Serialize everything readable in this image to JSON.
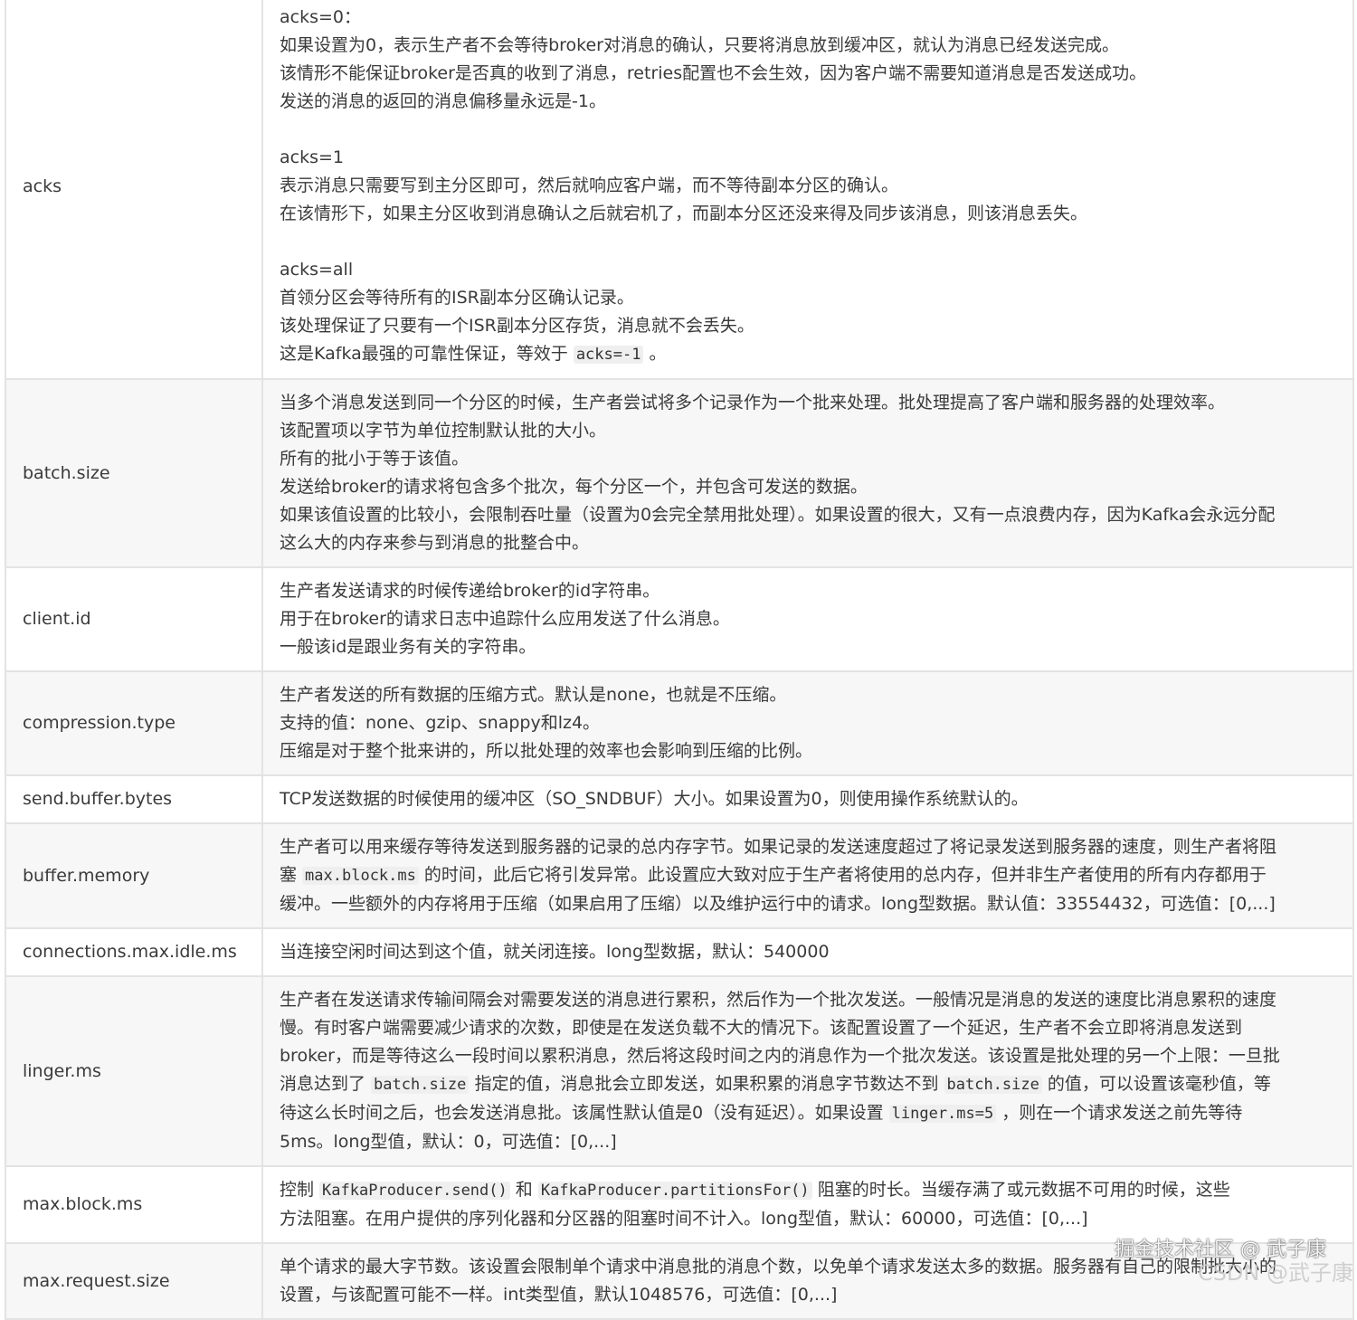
{
  "rows": [
    {
      "key": "acks",
      "lines": [
        "acks=0：",
        "如果设置为0，表示生产者不会等待broker对消息的确认，只要将消息放到缓冲区，就认为消息已经发送完成。",
        "该情形不能保证broker是否真的收到了消息，retries配置也不会生效，因为客户端不需要知道消息是否发送成功。",
        "发送的消息的返回的消息偏移量永远是-1。",
        "",
        "acks=1",
        "表示消息只需要写到主分区即可，然后就响应客户端，而不等待副本分区的确认。",
        "在该情形下，如果主分区收到消息确认之后就宕机了，而副本分区还没来得及同步该消息，则该消息丢失。",
        "",
        "acks=all",
        "首领分区会等待所有的ISR副本分区确认记录。",
        "该处理保证了只要有一个ISR副本分区存货，消息就不会丢失。",
        "这是Kafka最强的可靠性保证，等效于 `acks=-1` 。"
      ]
    },
    {
      "key": "batch.size",
      "lines": [
        "当多个消息发送到同一个分区的时候，生产者尝试将多个记录作为一个批来处理。批处理提高了客户端和服务器的处理效率。",
        "该配置项以字节为单位控制默认批的大小。",
        "所有的批小于等于该值。",
        "发送给broker的请求将包含多个批次，每个分区一个，并包含可发送的数据。",
        "如果该值设置的比较小，会限制吞吐量（设置为0会完全禁用批处理）。如果设置的很大，又有一点浪费内存，因为Kafka会永远分配",
        "这么大的内存来参与到消息的批整合中。"
      ]
    },
    {
      "key": "client.id",
      "lines": [
        "生产者发送请求的时候传递给broker的id字符串。",
        "用于在broker的请求日志中追踪什么应用发送了什么消息。",
        "一般该id是跟业务有关的字符串。"
      ]
    },
    {
      "key": "compression.type",
      "lines": [
        "生产者发送的所有数据的压缩方式。默认是none，也就是不压缩。",
        "支持的值：none、gzip、snappy和lz4。",
        "压缩是对于整个批来讲的，所以批处理的效率也会影响到压缩的比例。"
      ]
    },
    {
      "key": "send.buffer.bytes",
      "lines": [
        "TCP发送数据的时候使用的缓冲区（SO_SNDBUF）大小。如果设置为0，则使用操作系统默认的。"
      ]
    },
    {
      "key": "buffer.memory",
      "lines": [
        "生产者可以用来缓存等待发送到服务器的记录的总内存字节。如果记录的发送速度超过了将记录发送到服务器的速度，则生产者将阻",
        "塞 `max.block.ms` 的时间，此后它将引发异常。此设置应大致对应于生产者将使用的总内存，但并非生产者使用的所有内存都用于",
        "缓冲。一些额外的内存将用于压缩（如果启用了压缩）以及维护运行中的请求。long型数据。默认值：33554432，可选值：[0,...]"
      ]
    },
    {
      "key": "connections.max.idle.ms",
      "lines": [
        "当连接空闲时间达到这个值，就关闭连接。long型数据，默认：540000"
      ]
    },
    {
      "key": "linger.ms",
      "lines": [
        "生产者在发送请求传输间隔会对需要发送的消息进行累积，然后作为一个批次发送。一般情况是消息的发送的速度比消息累积的速度",
        "慢。有时客户端需要减少请求的次数，即使是在发送负载不大的情况下。该配置设置了一个延迟，生产者不会立即将消息发送到",
        "broker，而是等待这么一段时间以累积消息，然后将这段时间之内的消息作为一个批次发送。该设置是批处理的另一个上限：一旦批",
        "消息达到了 `batch.size` 指定的值，消息批会立即发送，如果积累的消息字节数达不到 `batch.size` 的值，可以设置该毫秒值，等",
        "待这么长时间之后，也会发送消息批。该属性默认值是0（没有延迟）。如果设置 `linger.ms=5` ，则在一个请求发送之前先等待",
        "5ms。long型值，默认：0，可选值：[0,...]"
      ]
    },
    {
      "key": "max.block.ms",
      "lines": [
        "控制 `KafkaProducer.send()` 和 `KafkaProducer.partitionsFor()` 阻塞的时长。当缓存满了或元数据不可用的时候，这些",
        "方法阻塞。在用户提供的序列化器和分区器的阻塞时间不计入。long型值，默认：60000，可选值：[0,...]"
      ]
    },
    {
      "key": "max.request.size",
      "lines": [
        "单个请求的最大字节数。该设置会限制单个请求中消息批的消息个数，以免单个请求发送太多的数据。服务器有自己的限制批大小的",
        "设置，与该配置可能不一样。int类型值，默认1048576，可选值：[0,...]"
      ]
    }
  ],
  "watermarks": {
    "juejin": "掘金技术社区 @ 武子康",
    "csdn": "CSDN @武子康"
  }
}
